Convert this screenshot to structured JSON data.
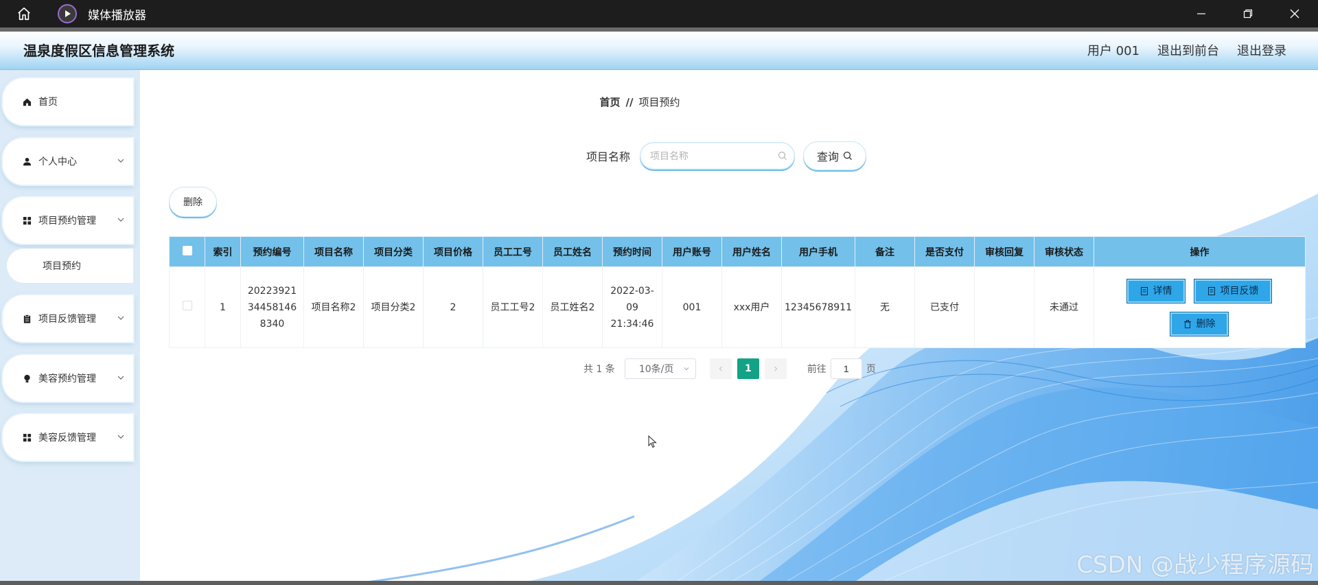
{
  "window": {
    "title": "媒体播放器",
    "controls": [
      "minimize-icon",
      "restore-icon",
      "close-icon"
    ]
  },
  "header": {
    "system_title": "温泉度假区信息管理系统",
    "user": "用户 001",
    "back_to_front": "退出到前台",
    "logout": "退出登录"
  },
  "sidebar": {
    "items": [
      {
        "label": "首页",
        "icon": "home-icon"
      },
      {
        "label": "个人中心",
        "icon": "user-icon",
        "expandable": true
      },
      {
        "label": "项目预约管理",
        "icon": "grid-icon",
        "expandable": true,
        "expanded": true,
        "children": [
          "项目预约"
        ]
      },
      {
        "label": "项目反馈管理",
        "icon": "clipboard-icon",
        "expandable": true
      },
      {
        "label": "美容预约管理",
        "icon": "bulb-icon",
        "expandable": true
      },
      {
        "label": "美容反馈管理",
        "icon": "grid-icon",
        "expandable": true
      }
    ]
  },
  "breadcrumb": {
    "home": "首页",
    "separator": "//",
    "current": "项目预约"
  },
  "search": {
    "label": "项目名称",
    "placeholder": "项目名称",
    "value": "",
    "button": "查询"
  },
  "toolbar": {
    "delete": "删除"
  },
  "table": {
    "columns": [
      "索引",
      "预约编号",
      "项目名称",
      "项目分类",
      "项目价格",
      "员工工号",
      "员工姓名",
      "预约时间",
      "用户账号",
      "用户姓名",
      "用户手机",
      "备注",
      "是否支付",
      "审核回复",
      "审核状态",
      "操作"
    ],
    "rows": [
      {
        "index": "1",
        "booking_no": "20223921 34458146 8340",
        "item_name": "项目名称2",
        "item_category": "项目分类2",
        "price": "2",
        "staff_no": "员工工号2",
        "staff_name": "员工姓名2",
        "booking_time": "2022-03-09 21:34:46",
        "account": "001",
        "user_name": "xxx用户",
        "phone": "12345678911",
        "remark": "无",
        "paid": "已支付",
        "review_reply": "",
        "review_status": "未通过",
        "actions": {
          "detail": "详情",
          "feedback": "项目反馈",
          "delete": "删除"
        }
      }
    ]
  },
  "pagination": {
    "total": "共 1 条",
    "page_size": "10条/页",
    "current_page": "1",
    "goto_label": "前往",
    "goto_value": "1",
    "page_suffix": "页"
  },
  "watermark": "CSDN @战少程序源码",
  "colors": {
    "accent": "#73c0ea",
    "button": "#2ea6e8",
    "pager_active": "#13a286",
    "sidebar_bg": "#dcebf7"
  }
}
